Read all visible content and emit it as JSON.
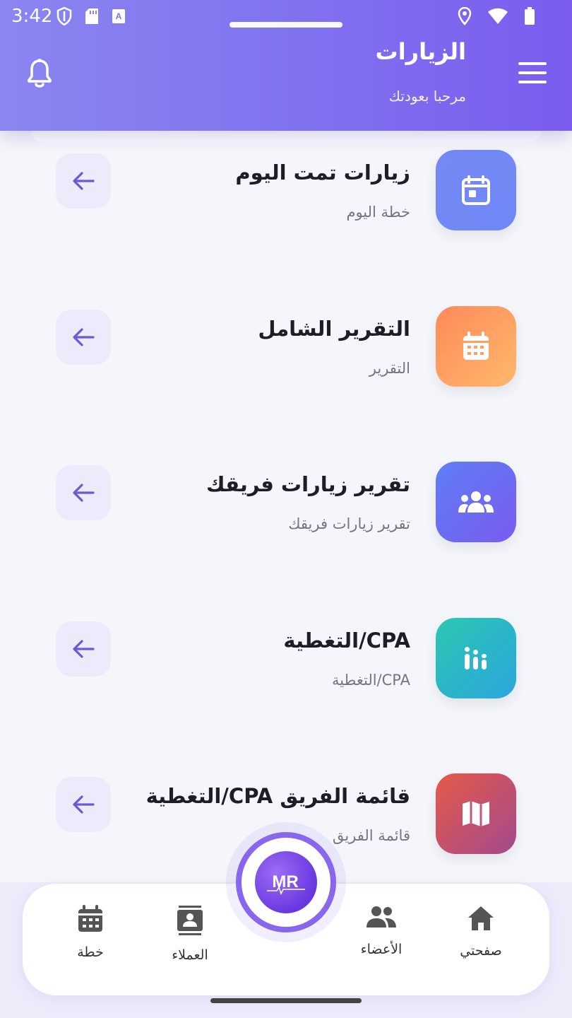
{
  "status_bar": {
    "time": "3:42"
  },
  "header": {
    "title": "الزيارات",
    "subtitle": "مرحبا بعودتك"
  },
  "rows": [
    {
      "title": "زيارات تمت اليوم",
      "subtitle": "خطة اليوم",
      "icon": "calendar-icon",
      "gradient": [
        "#6b8bf5",
        "#7b78f2"
      ]
    },
    {
      "title": "التقرير الشامل",
      "subtitle": "التقرير",
      "icon": "calendar-grid-icon",
      "gradient": [
        "#ff8a5c",
        "#ffb66a"
      ]
    },
    {
      "title": "تقرير زيارات فريقك",
      "subtitle": "تقرير زيارات فريقك",
      "icon": "team-icon",
      "gradient": [
        "#5f7cf6",
        "#7a5cee"
      ]
    },
    {
      "title": "CPA/التغطية",
      "subtitle": "CPA/التغطية",
      "icon": "bar-chart-icon",
      "gradient": [
        "#27c6b0",
        "#2aa8dc"
      ]
    },
    {
      "title": "قائمة الفريق CPA/التغطية",
      "subtitle": "قائمة الفريق",
      "icon": "map-icon",
      "gradient": [
        "#e8584b",
        "#a64b8b"
      ]
    }
  ],
  "bottom_nav": {
    "plan": "خطة",
    "clients": "العملاء",
    "members": "الأعضاء",
    "home": "صفحتي",
    "fab_logo": "MR"
  },
  "colors": {
    "accent": "#7b5cee",
    "arrow": "#6a5ad6"
  }
}
